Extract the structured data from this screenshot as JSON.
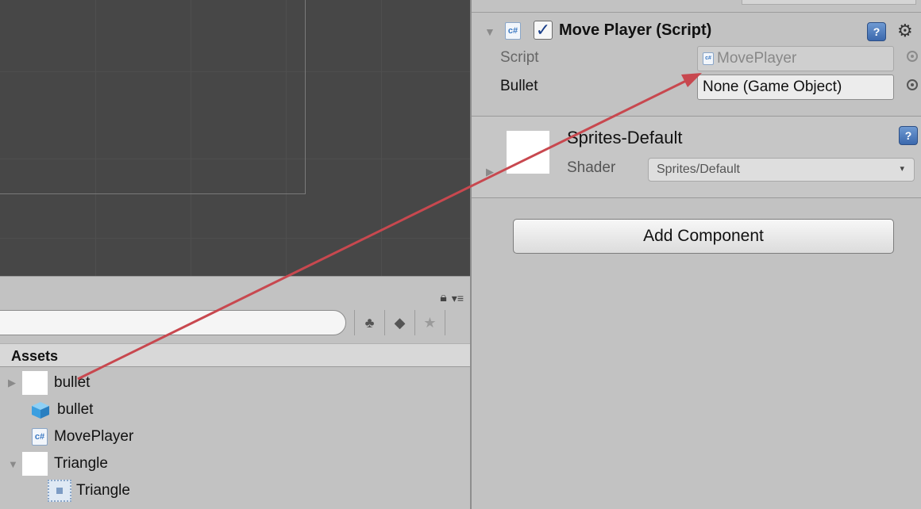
{
  "colors": {
    "scene_bg": "#474747",
    "panel_bg": "#c2c2c2",
    "arrow": "#c8484f",
    "help_icon": "#4a79bd"
  },
  "project": {
    "toolbar_icons": [
      "lock-icon",
      "menu-icon"
    ],
    "filter_buttons": [
      "shapes-icon",
      "tag-icon",
      "star-icon"
    ],
    "assets_header": "Assets",
    "items": [
      {
        "icon": "white-thumb",
        "label": "bullet",
        "foldout": true
      },
      {
        "icon": "prefab-cube-icon",
        "label": "bullet",
        "foldout": false
      },
      {
        "icon": "script-icon",
        "label": "MovePlayer",
        "foldout": false
      },
      {
        "icon": "white-thumb",
        "label": "Triangle",
        "foldout": true
      },
      {
        "icon": "sprite-icon",
        "label": "Triangle",
        "foldout": false
      }
    ]
  },
  "inspector": {
    "component": {
      "title": "Move Player (Script)",
      "enabled": true,
      "script_label": "Script",
      "script_value": "MovePlayer",
      "bullet_label": "Bullet",
      "bullet_value": "None (Game Object)"
    },
    "material": {
      "name": "Sprites-Default",
      "shader_label": "Shader",
      "shader_value": "Sprites/Default"
    },
    "add_component_label": "Add Component"
  }
}
